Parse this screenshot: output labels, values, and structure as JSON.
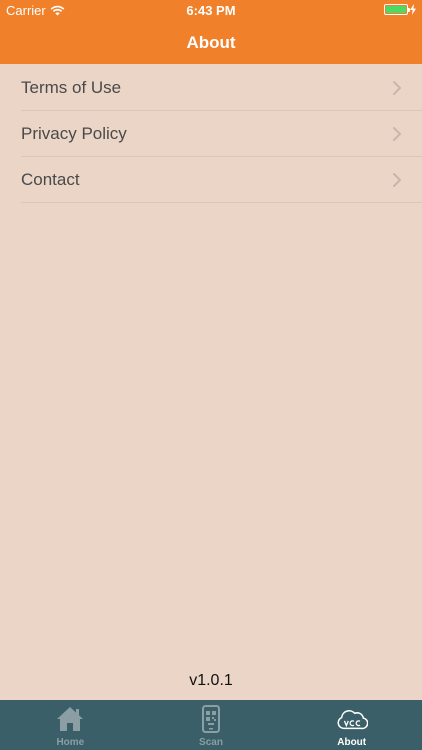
{
  "status_bar": {
    "carrier": "Carrier",
    "time": "6:43 PM"
  },
  "header": {
    "title": "About"
  },
  "menu": {
    "items": [
      {
        "label": "Terms of Use"
      },
      {
        "label": "Privacy Policy"
      },
      {
        "label": "Contact"
      }
    ]
  },
  "footer": {
    "version": "v1.0.1"
  },
  "tabbar": {
    "tabs": [
      {
        "label": "Home",
        "icon": "home-icon"
      },
      {
        "label": "Scan",
        "icon": "phone-scan-icon"
      },
      {
        "label": "About",
        "icon": "cloud-vcc-icon",
        "active": true
      }
    ]
  },
  "colors": {
    "header_bg": "#f0802a",
    "page_bg": "#ead5c7",
    "tabbar_bg": "#3a5f69",
    "battery": "#4cd964"
  }
}
